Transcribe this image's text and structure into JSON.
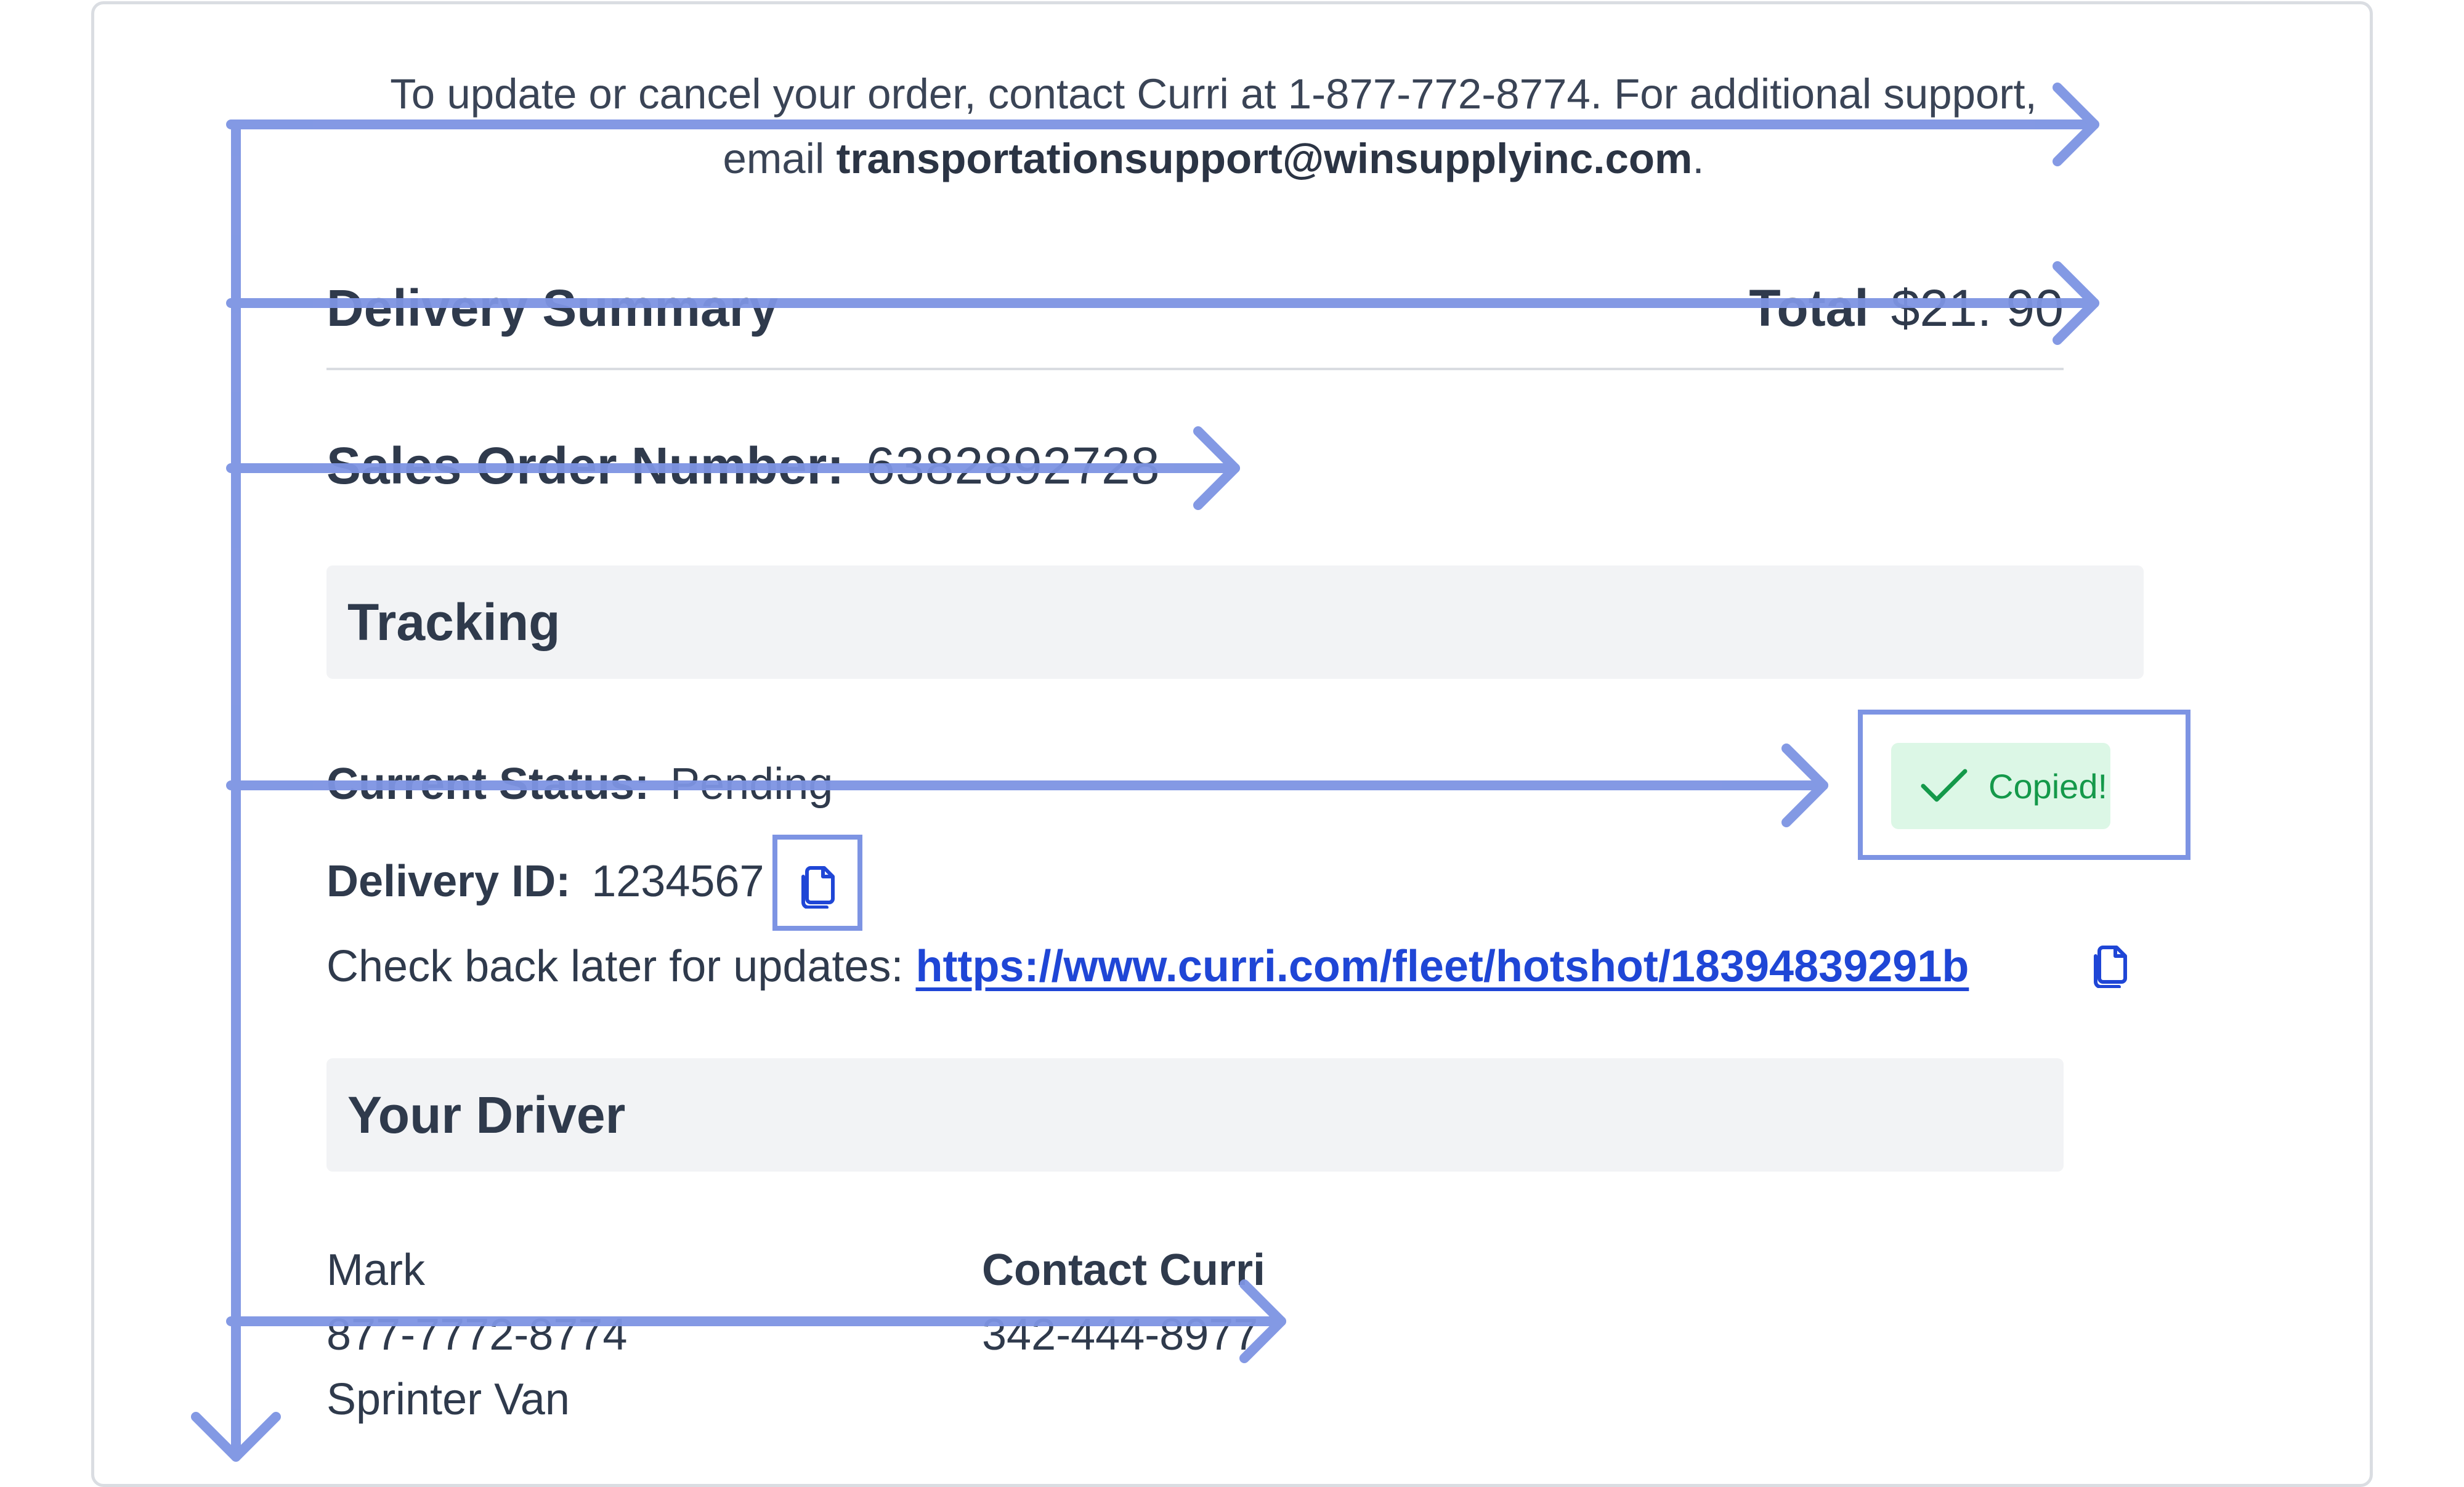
{
  "notice": {
    "prefix": "To update or cancel your order, contact Curri at 1-877-772-8774. For additional support, email ",
    "email": "transportationsupport@winsupplyinc.com",
    "suffix": "."
  },
  "summary": {
    "title": "Delivery Summary",
    "total_label": "Total",
    "total_value": "$21. 90"
  },
  "order": {
    "label": "Sales Order Number:",
    "value": "6382892728"
  },
  "tracking": {
    "title": "Tracking",
    "status_label": "Current Status:",
    "status_value": "Pending",
    "delivery_label": "Delivery ID:",
    "delivery_value": "1234567",
    "check_text": "Check back later for updates:",
    "tracking_url": "https://www.curri.com/fleet/hotshot/18394839291b",
    "copy_icon": "copy-icon"
  },
  "toast": {
    "text": "Copied!",
    "icon": "checkmark-icon"
  },
  "driver": {
    "title": "Your Driver",
    "name": "Mark",
    "phone": "877-7772-8774",
    "vehicle": "Sprinter Van",
    "contact_label": "Contact Curri",
    "contact_phone": "342-444-8977"
  },
  "colors": {
    "accent": "#7d94e3",
    "link": "#1f46d6",
    "toast_bg": "#dcf7e6",
    "toast_text": "#14994a",
    "section_bg": "#f2f3f5"
  }
}
